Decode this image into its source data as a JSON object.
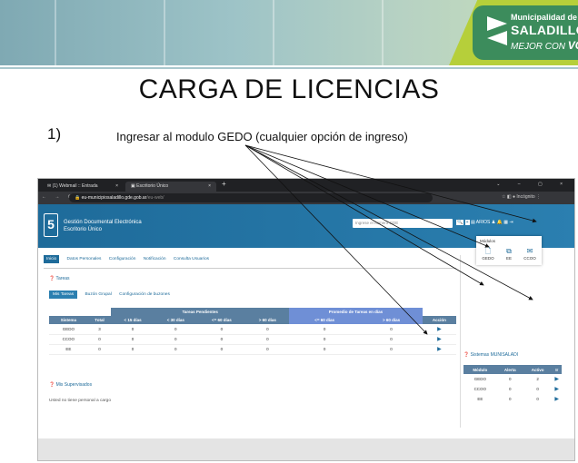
{
  "logo": {
    "line1": "Municipalidad de",
    "line2": "SALADILLO",
    "line3_a": "MEJOR",
    "line3_b": "CON",
    "line3_c": "VOS"
  },
  "slide": {
    "title": "CARGA DE LICENCIAS",
    "step_number": "1)",
    "instruction": "Ingresar al modulo GEDO (cualquier opción de ingreso)"
  },
  "browser": {
    "tabs": [
      {
        "label": "(1) Webmail :: Entrada"
      },
      {
        "label": "Escritorio Único"
      }
    ],
    "new_tab": "+",
    "url_host": "eu-municipiosaladillo.gde.gob.ar",
    "url_path": "/eu-web/",
    "profile": "Incógnito"
  },
  "app": {
    "title_line1": "Gestión Documental Electrónica",
    "title_line2": "Escritorio Único",
    "search_placeholder": "Ingrese el número GDE",
    "user": "ARIOS",
    "main_tabs": [
      {
        "label": "Inicio"
      },
      {
        "label": "Datos Personales"
      },
      {
        "label": "Configuración"
      },
      {
        "label": "Notificación"
      },
      {
        "label": "Consulta Usuarios"
      }
    ],
    "tareas_title": "Tareas",
    "sub_tabs": [
      {
        "label": "Mis Tareas"
      },
      {
        "label": "Buzón Grupal"
      },
      {
        "label": "Configuración de buzones"
      }
    ],
    "table_group_headers": {
      "pending": "Tareas Pendientes",
      "average": "Promedio de Tareas en días"
    },
    "table_headers": [
      "Sistema",
      "Total",
      "< 15 días",
      "< 30 días",
      "<= 60 días",
      "> 60 días",
      "<= 60 días",
      "> 60 días",
      "Acción"
    ],
    "rows": [
      {
        "sistema": "GEDO",
        "cells": [
          "3",
          "0",
          "0",
          "0",
          "0",
          "0",
          "0"
        ]
      },
      {
        "sistema": "CCOO",
        "cells": [
          "0",
          "0",
          "0",
          "0",
          "0",
          "0",
          "0"
        ]
      },
      {
        "sistema": "EE",
        "cells": [
          "0",
          "0",
          "0",
          "0",
          "0",
          "0",
          "0"
        ]
      }
    ],
    "sistemas_title": "Sistemas MUNISALADI",
    "sistemas_headers": [
      "Módulo",
      "Alerta",
      "Activo",
      "Ir"
    ],
    "sistemas_rows": [
      {
        "modulo": "GEDO",
        "alerta": "0",
        "activo": "2"
      },
      {
        "modulo": "CCOO",
        "alerta": "0",
        "activo": "0"
      },
      {
        "modulo": "EE",
        "alerta": "0",
        "activo": "0"
      }
    ],
    "supervisados_title": "Mis Supervisados",
    "supervisados_msg": "Usted no tiene personal a cargo",
    "modules_popup": {
      "title": "Módulos",
      "items": [
        {
          "label": "GEDO"
        },
        {
          "label": "EE"
        },
        {
          "label": "CCOO"
        }
      ]
    }
  }
}
